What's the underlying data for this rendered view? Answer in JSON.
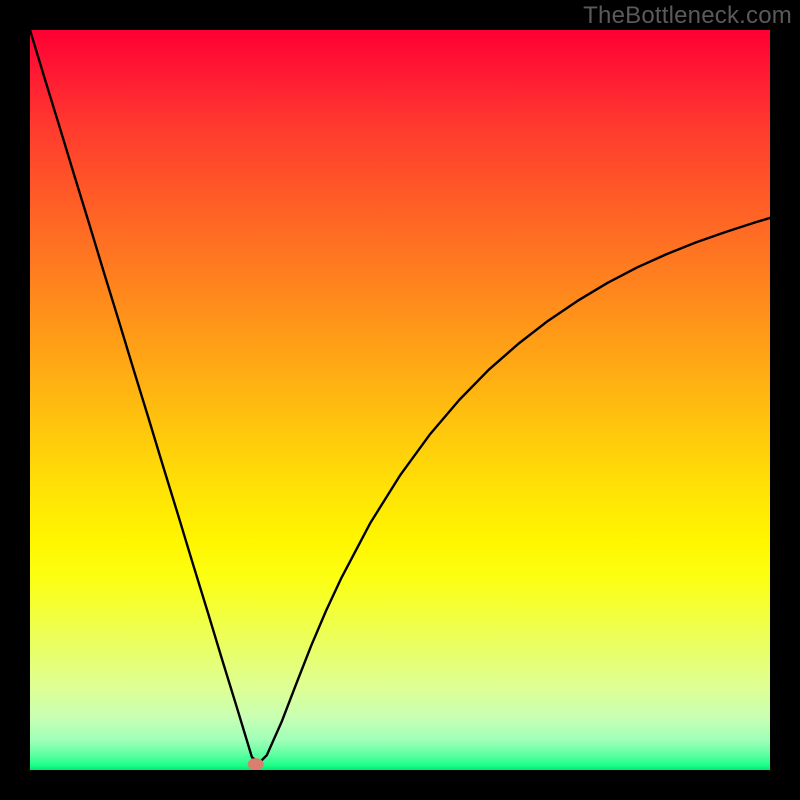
{
  "watermark": "TheBottleneck.com",
  "chart_data": {
    "type": "line",
    "title": "",
    "xlabel": "",
    "ylabel": "",
    "xlim": [
      0,
      100
    ],
    "ylim": [
      0,
      100
    ],
    "grid": false,
    "legend": false,
    "curve_x": [
      0,
      2,
      4,
      6,
      8,
      10,
      12,
      14,
      16,
      18,
      20,
      22,
      24,
      26,
      28,
      29,
      30,
      31,
      32,
      34,
      36,
      38,
      40,
      42,
      46,
      50,
      54,
      58,
      62,
      66,
      70,
      74,
      78,
      82,
      86,
      90,
      94,
      98,
      100
    ],
    "curve_y": [
      100,
      93.4,
      86.9,
      80.3,
      73.8,
      67.2,
      60.7,
      54.1,
      47.6,
      41.0,
      34.5,
      27.9,
      21.4,
      14.8,
      8.3,
      5.0,
      1.7,
      1.0,
      2.0,
      6.5,
      11.7,
      16.8,
      21.5,
      25.8,
      33.4,
      39.8,
      45.3,
      50.0,
      54.1,
      57.6,
      60.7,
      63.4,
      65.8,
      67.9,
      69.7,
      71.3,
      72.7,
      74.0,
      74.6
    ],
    "min_point": {
      "x": 30.5,
      "y": 0.8
    },
    "marker_color": "#d6806d",
    "stroke_color": "#000000",
    "stroke_width": 2.4,
    "background": {
      "type": "vertical-gradient",
      "stops": [
        {
          "pos": 0.0,
          "color": "#ff0033"
        },
        {
          "pos": 0.5,
          "color": "#ffca0c"
        },
        {
          "pos": 0.69,
          "color": "#fff600"
        },
        {
          "pos": 0.93,
          "color": "#c7ffb4"
        },
        {
          "pos": 1.0,
          "color": "#00e874"
        }
      ]
    }
  }
}
